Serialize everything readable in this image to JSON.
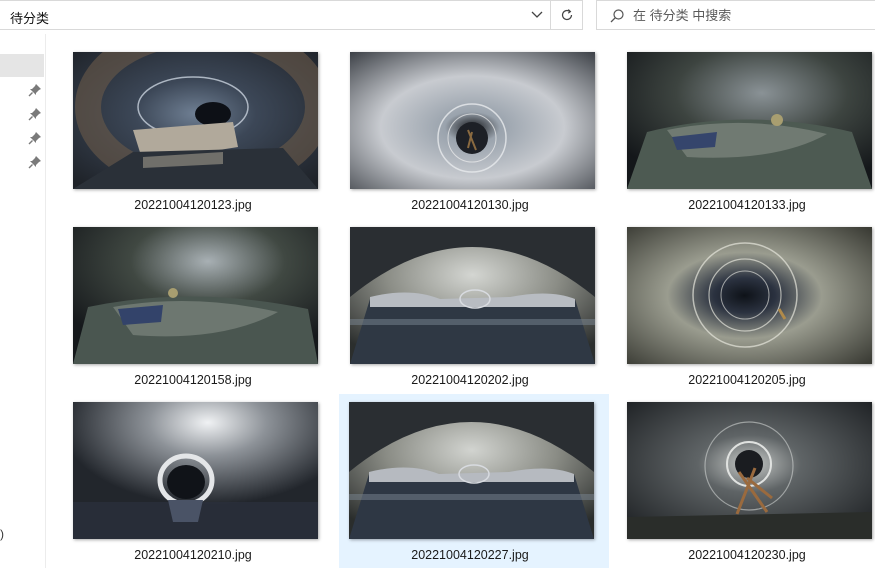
{
  "address_bar": {
    "path": "待分类"
  },
  "search": {
    "placeholder": "在 待分类 中搜索"
  },
  "nav": {
    "clipped_text": ")"
  },
  "files": [
    {
      "name": "20221004120123.jpg",
      "scene": "pipe-with-debris-left",
      "selected": false
    },
    {
      "name": "20221004120130.jpg",
      "scene": "bright-pipe-center-ring",
      "selected": false
    },
    {
      "name": "20221004120133.jpg",
      "scene": "dark-sediment-mound",
      "selected": false
    },
    {
      "name": "20221004120158.jpg",
      "scene": "dark-sediment-mound-2",
      "selected": false
    },
    {
      "name": "20221004120202.jpg",
      "scene": "pipe-water-reflection",
      "selected": false
    },
    {
      "name": "20221004120205.jpg",
      "scene": "concentric-ring-pipe",
      "selected": false
    },
    {
      "name": "20221004120210.jpg",
      "scene": "flashlight-pipe-dark-ring",
      "selected": false
    },
    {
      "name": "20221004120227.jpg",
      "scene": "pipe-water-reflection-2",
      "selected": true
    },
    {
      "name": "20221004120230.jpg",
      "scene": "pipe-with-roots",
      "selected": false
    }
  ]
}
